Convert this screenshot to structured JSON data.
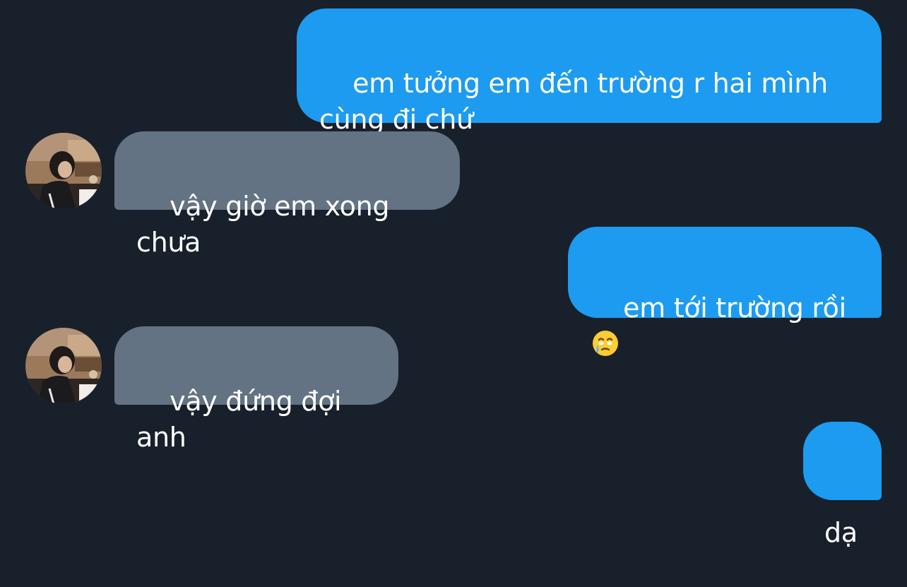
{
  "conversation": {
    "messages": [
      {
        "sender": "me",
        "text": "em tưởng em đến trường r hai mình\ncùng đi chứ"
      },
      {
        "sender": "other",
        "text": "vậy giờ em xong chưa"
      },
      {
        "sender": "me",
        "text": "em tới trường rồi",
        "emoji": "face-holding-back-tears-emoji"
      },
      {
        "sender": "other",
        "text": "vậy đứng đợi anh"
      },
      {
        "sender": "me",
        "text": "dạ"
      }
    ]
  },
  "colors": {
    "background": "#18202b",
    "sent_bubble": "#1d9bf0",
    "received_bubble": "#637383",
    "text": "#ffffff"
  }
}
